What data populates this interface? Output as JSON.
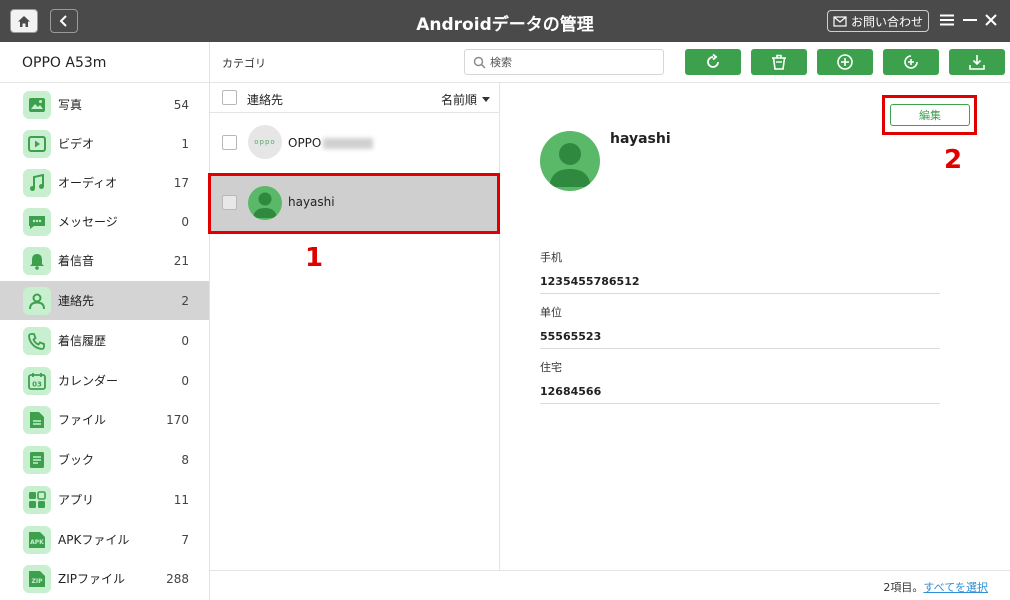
{
  "app": {
    "title": "Androidデータの管理",
    "contact_label": "お問い合わせ"
  },
  "sidebar": {
    "device": "OPPO A53m",
    "items": [
      {
        "label": "写真",
        "count": "54",
        "icon": "photo-icon"
      },
      {
        "label": "ビデオ",
        "count": "1",
        "icon": "video-icon"
      },
      {
        "label": "オーディオ",
        "count": "17",
        "icon": "music-icon"
      },
      {
        "label": "メッセージ",
        "count": "0",
        "icon": "message-icon"
      },
      {
        "label": "着信音",
        "count": "21",
        "icon": "bell-icon"
      },
      {
        "label": "連絡先",
        "count": "2",
        "icon": "contact-icon"
      },
      {
        "label": "着信履歴",
        "count": "0",
        "icon": "phone-icon"
      },
      {
        "label": "カレンダー",
        "count": "0",
        "icon": "calendar-icon"
      },
      {
        "label": "ファイル",
        "count": "170",
        "icon": "file-icon"
      },
      {
        "label": "ブック",
        "count": "8",
        "icon": "book-icon"
      },
      {
        "label": "アプリ",
        "count": "11",
        "icon": "apps-icon"
      },
      {
        "label": "APKファイル",
        "count": "7",
        "icon": "apk-icon"
      },
      {
        "label": "ZIPファイル",
        "count": "288",
        "icon": "zip-icon"
      }
    ],
    "active_index": 5,
    "calendar_icon_text": "03",
    "apk_icon_text": "APK",
    "zip_icon_text": "ZIP"
  },
  "toolbar": {
    "category_label": "カテゴリ",
    "search_placeholder": "検索",
    "buttons": [
      "refresh-icon",
      "delete-icon",
      "add-icon",
      "import-icon",
      "export-icon"
    ]
  },
  "list": {
    "header_title": "連絡先",
    "sort_label": "名前順",
    "contacts": [
      {
        "name": "OPPO",
        "avatar_text": "oppo"
      },
      {
        "name": "hayashi"
      }
    ]
  },
  "detail": {
    "edit_label": "編集",
    "name": "hayashi",
    "fields": [
      {
        "label": "手机",
        "value": "1235455786512"
      },
      {
        "label": "单位",
        "value": "55565523"
      },
      {
        "label": "住宅",
        "value": "12684566"
      }
    ]
  },
  "annotations": [
    "1",
    "2"
  ],
  "footer": {
    "count_text": "2項目。",
    "select_all": "すべてを選択"
  },
  "colors": {
    "accent": "#3da04d",
    "titlebar": "#4a4a4a",
    "icon_bg": "#c8efcf",
    "annotation": "#e00000",
    "link": "#2e8fd6"
  }
}
